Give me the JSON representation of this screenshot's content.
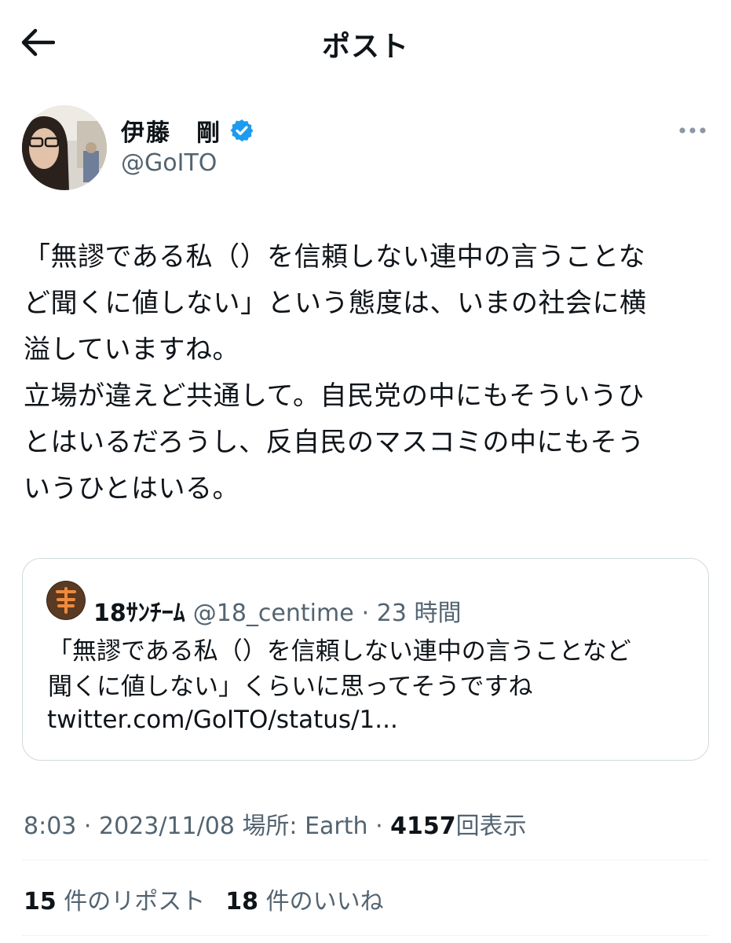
{
  "header": {
    "title": "ポスト",
    "back_icon": "arrow-left-icon"
  },
  "author": {
    "display_name": "伊藤　剛",
    "handle": "@GoITO",
    "verified_color": "#1d9bf0"
  },
  "tweet": {
    "text": "「無謬である私（）を信頼しない連中の言うことな\nど聞くに値しない」という態度は、いまの社会に横\n溢していますね。\n立場が違えど共通して。自民党の中にもそういうひ\nとはいるだろうし、反自民のマスコミの中にもそう\nいうひとはいる。"
  },
  "quote": {
    "name": "18ｻﾝﾁｰﾑ",
    "handle": "@18_centime",
    "time": "· 23 時間",
    "text": "「無謬である私（）を信頼しない連中の言うことなど\n聞くに値しない」くらいに思ってそうですね",
    "link": "twitter.com/GoITO/status/1..."
  },
  "meta": {
    "time": "8:03 · 2023/11/08",
    "location": "場所: Earth ·",
    "views_count": "4157",
    "views_label": "回表示"
  },
  "stats": {
    "reposts_count": "15",
    "reposts_label": "件のリポスト",
    "likes_count": "18",
    "likes_label": "件のいいね"
  }
}
